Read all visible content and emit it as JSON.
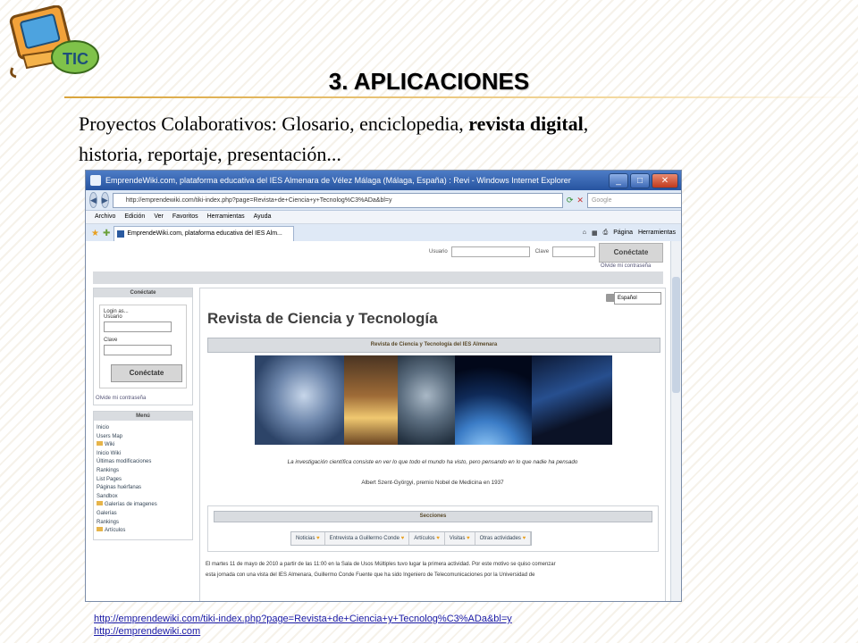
{
  "slide": {
    "title": "3. APLICACIONES",
    "body_prefix": "Proyectos Colaborativos:  Glosario, enciclopedia, ",
    "body_bold": "revista digital",
    "body_suffix": ",",
    "body_line2": "historia, reportaje, presentación...",
    "logo_text": "TIC",
    "links": [
      "http://emprendewiki.com/tiki-index.php?page=Revista+de+Ciencia+y+Tecnolog%C3%ADa&bl=y",
      "http://emprendewiki.com"
    ]
  },
  "browser": {
    "window_title": "EmprendeWiki.com, plataforma educativa del IES Almenara de Vélez Málaga (Málaga, España) : Revi - Windows Internet Explorer",
    "address": "http://emprendewiki.com/tiki-index.php?page=Revista+de+Ciencia+y+Tecnolog%C3%ADa&bl=y",
    "search_placeholder": "Google",
    "menu": [
      "Archivo",
      "Edición",
      "Ver",
      "Favoritos",
      "Herramientas",
      "Ayuda"
    ],
    "tab_label": "EmprendeWiki.com, plataforma educativa del IES Alm...",
    "toolbar_right": [
      "Página",
      "Herramientas"
    ]
  },
  "site": {
    "top_login": {
      "user_label": "Usuario",
      "pass_label": "Clave",
      "button": "Conéctate",
      "forgot": "Olvide mi contraseña"
    },
    "side_login": {
      "header": "Conéctate",
      "legend": "Login as...",
      "user_label": "Usuario",
      "pass_label": "Clave",
      "button": "Conéctate",
      "forgot": "Olvide mi contraseña"
    },
    "menu_header": "Menú",
    "menu_items": [
      "Inicio",
      "Users Map",
      "Wiki",
      "Inicio Wiki",
      "Últimas modificaciones",
      "Rankings",
      "List Pages",
      "Páginas huérfanas",
      "Sandbox",
      "Galerías de imagenes",
      "Galerías",
      "Rankings",
      "Artículos"
    ],
    "language": "Español",
    "page_title": "Revista de Ciencia y Tecnología",
    "subtitle_bar": "Revista de Ciencia y Tecnología del IES Almenara",
    "quote": "La investigación científica consiste en ver lo que todo el mundo ha visto, pero pensando en lo que nadie ha pensado",
    "author": "Albert Szent-Györgyi, premio Nobel de Medicina en 1937",
    "sections_header": "Secciones",
    "sections": [
      "Noticias",
      "Entrevista a Guillermo Conde",
      "Artículos",
      "Visitas",
      "Otras actividades"
    ],
    "paragraph_line1": "El martes 11 de mayo de 2010 a partir de las 11:00 en la Sala de Usos Múltiples tuvo lugar la primera actividad. Por este motivo se quiso comenzar",
    "paragraph_line2": "esta jornada con una vista del IES Almenara, Guillermo Conde Fuente que ha sido Ingeniero de Telecomunicaciones por la Universidad de"
  }
}
